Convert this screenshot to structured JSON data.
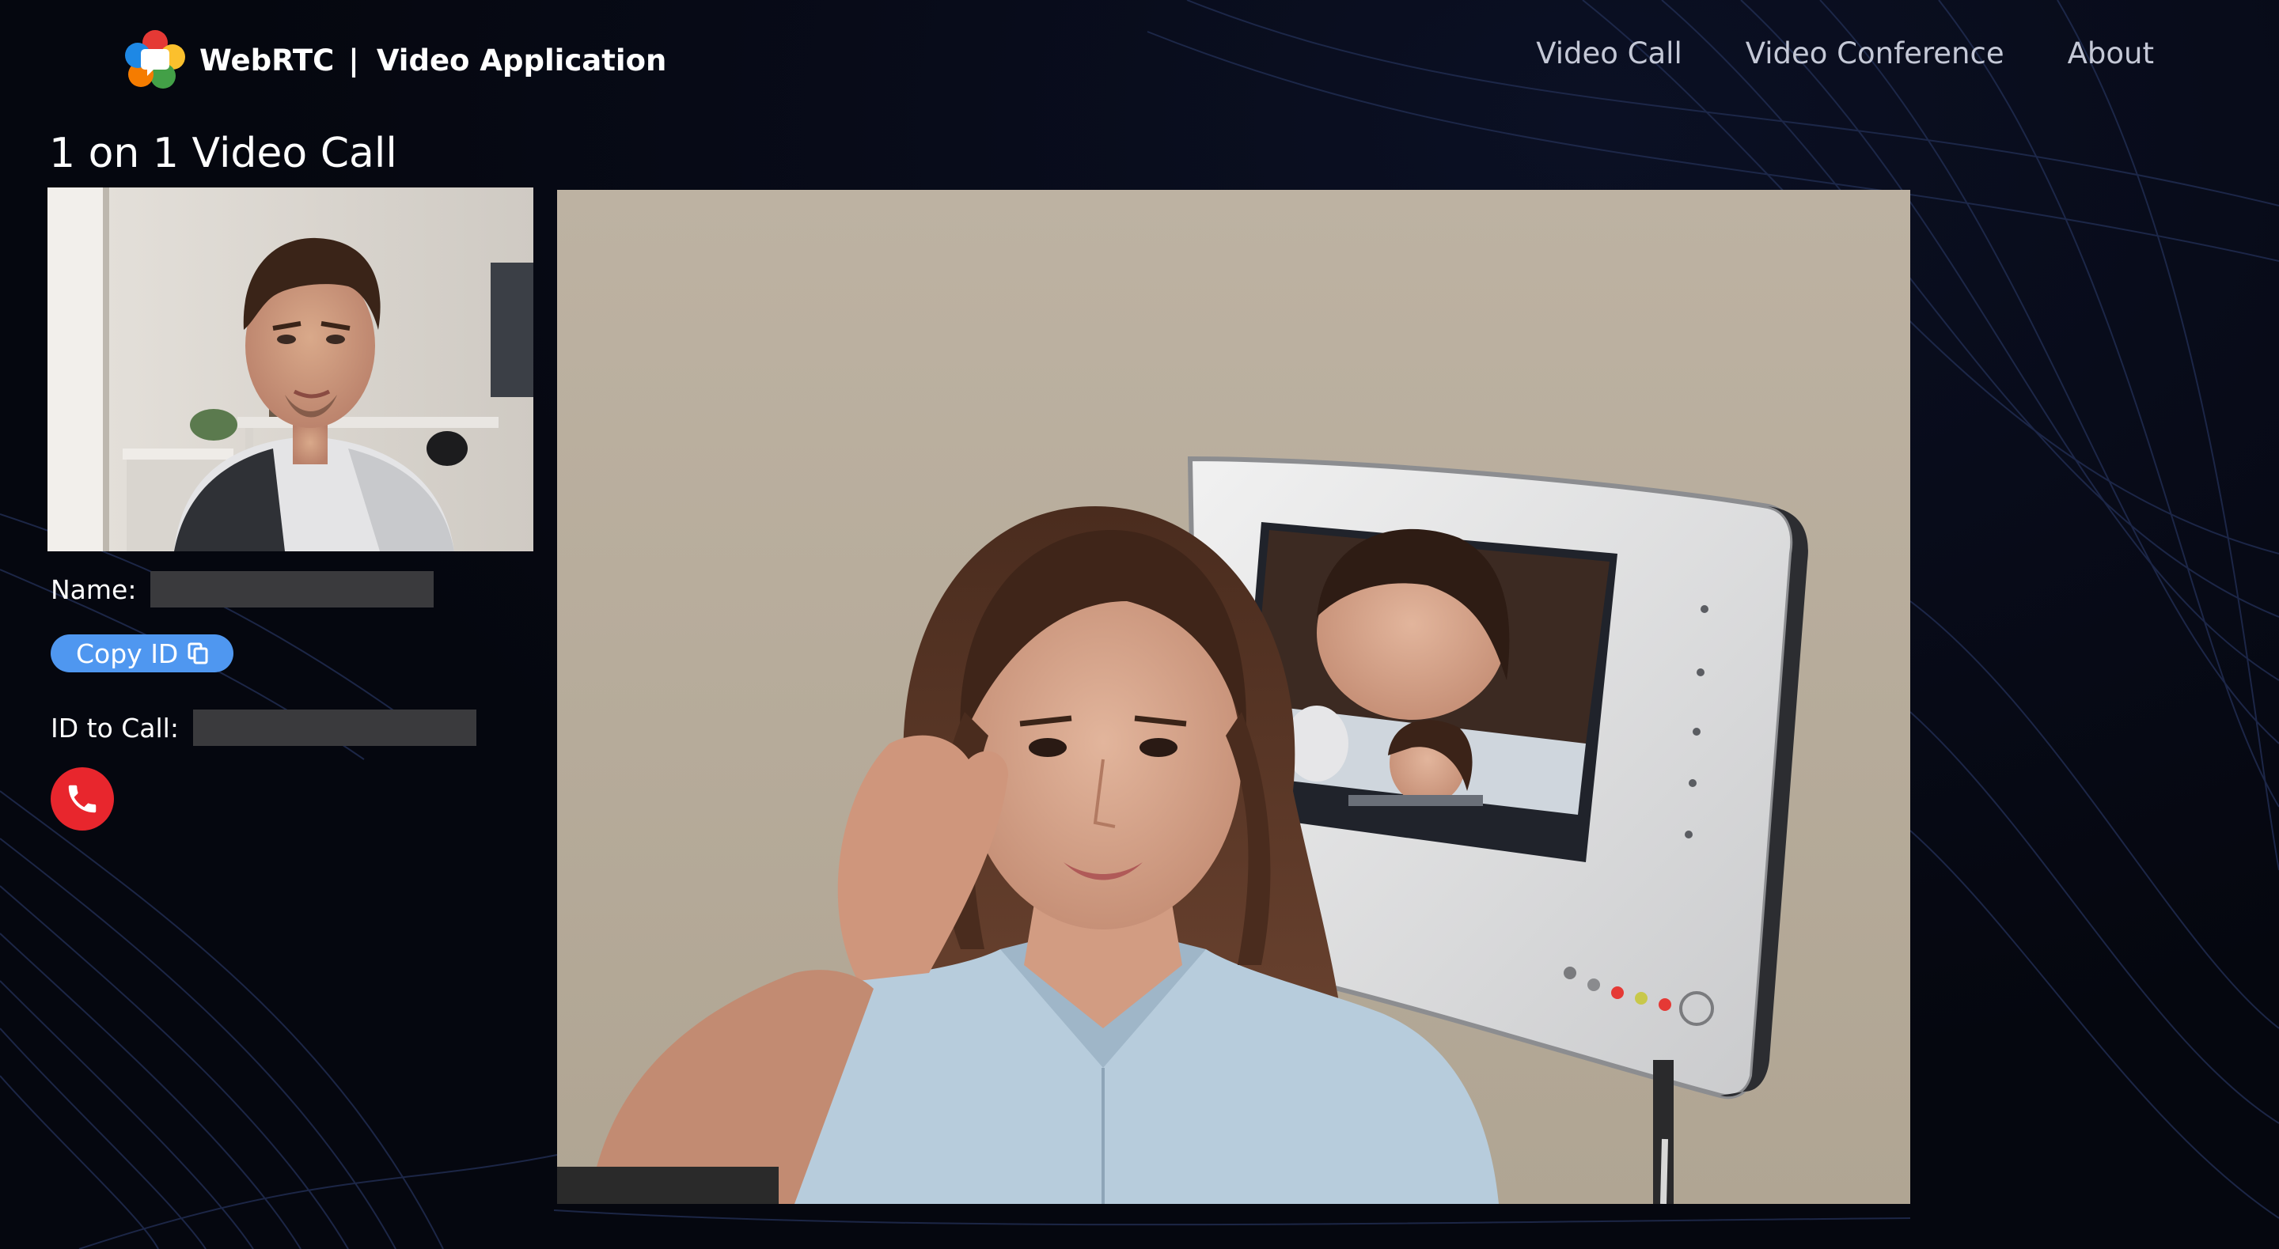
{
  "brand": {
    "name": "WebRTC",
    "separator": "|",
    "subtitle": "Video Application",
    "logo_icon": "webrtc-logo-icon"
  },
  "nav": {
    "items": [
      {
        "label": "Video Call"
      },
      {
        "label": "Video Conference"
      },
      {
        "label": "About"
      }
    ]
  },
  "page": {
    "title": "1 on 1 Video Call"
  },
  "local_video": {
    "icon": "local-camera-feed"
  },
  "remote_video": {
    "icon": "remote-camera-feed"
  },
  "form": {
    "name_label": "Name:",
    "name_value": "",
    "copy_label": "Copy ID",
    "copy_icon": "copy-icon",
    "id_label": "ID to Call:",
    "id_value": "",
    "call_icon": "phone-icon"
  },
  "colors": {
    "background": "#05070f",
    "accent_blue": "#4f97f0",
    "call_red": "#e8262d",
    "input_bg": "#3a3a3d",
    "nav_text": "#c4c8d6"
  }
}
